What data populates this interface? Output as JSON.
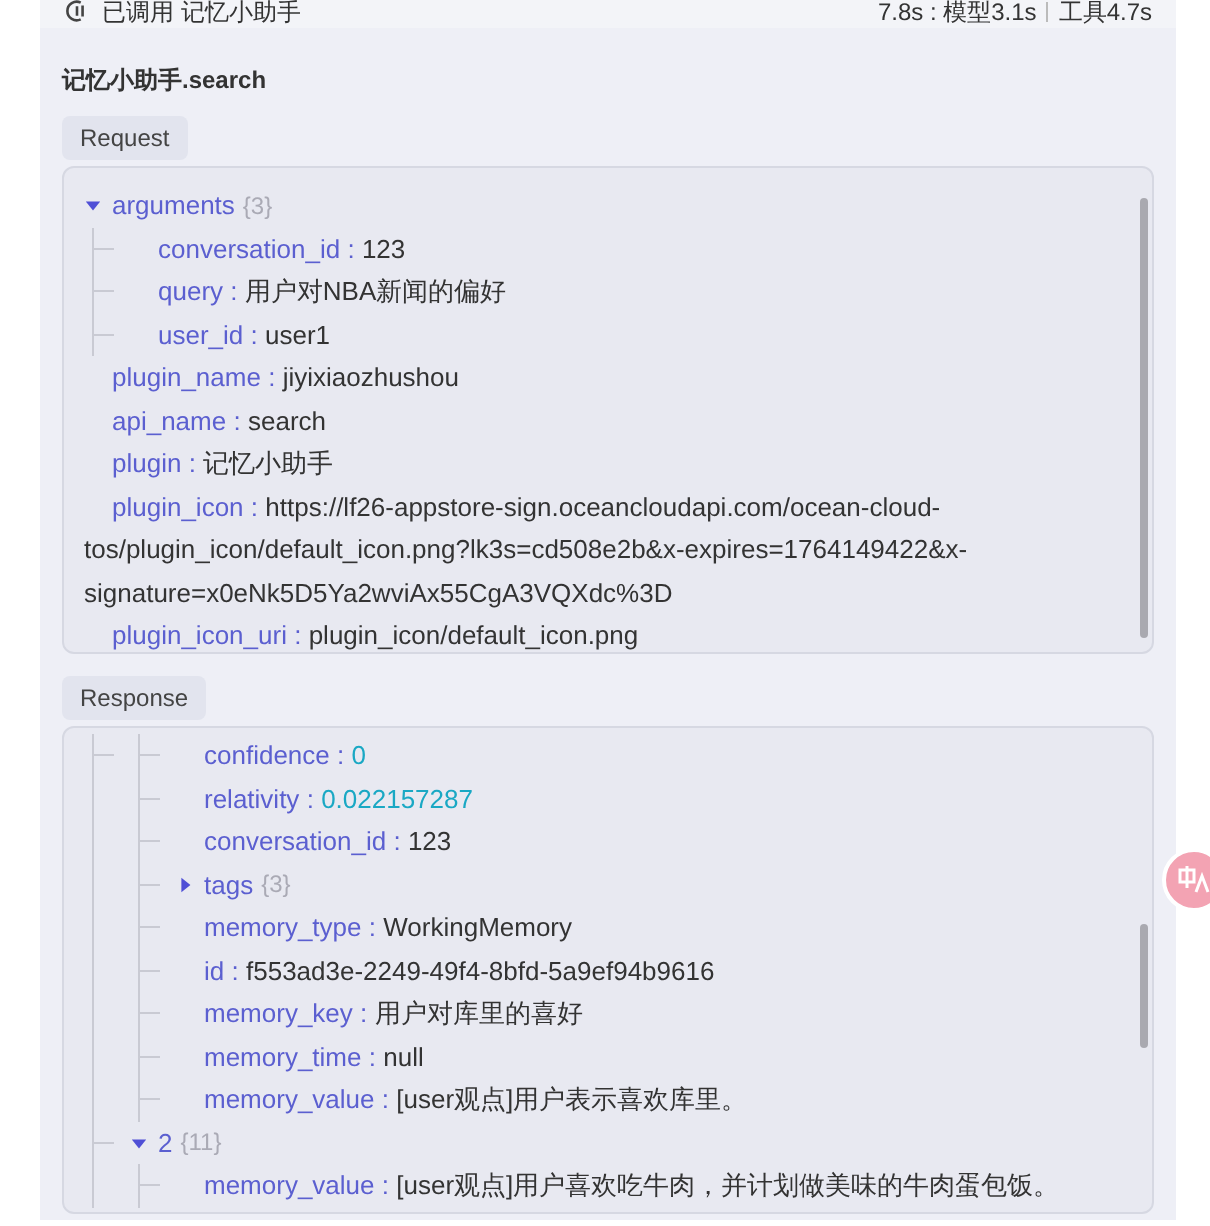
{
  "header": {
    "status": "已调用 记忆小助手",
    "timing_total": "7.8s : 模型3.1s",
    "timing_tool": "工具4.7s"
  },
  "title": "记忆小助手.search",
  "separator": ":",
  "request": {
    "label": "Request",
    "tree": [
      {
        "key": "arguments",
        "count": "{3}",
        "expanded": true,
        "children": [
          {
            "key": "conversation_id",
            "value": "123"
          },
          {
            "key": "query",
            "value": "用户对NBA新闻的偏好"
          },
          {
            "key": "user_id",
            "value": "user1"
          }
        ]
      },
      {
        "key": "plugin_name",
        "value": "jiyixiaozhushou"
      },
      {
        "key": "api_name",
        "value": "search"
      },
      {
        "key": "plugin",
        "value": "记忆小助手"
      },
      {
        "key": "plugin_icon",
        "value": "https://lf26-appstore-sign.oceancloudapi.com/ocean-cloud-tos/plugin_icon/default_icon.png?lk3s=cd508e2b&x-expires=1764149422&x-signature=x0eNk5D5Ya2wviAx55CgA3VQXdc%3D"
      },
      {
        "key": "plugin_icon_uri",
        "value": "plugin_icon/default_icon.png"
      }
    ]
  },
  "response": {
    "label": "Response",
    "tree": [
      {
        "children": [
          {
            "children": [
              {
                "key": "confidence",
                "value": "0",
                "kind": "number"
              },
              {
                "key": "relativity",
                "value": "0.022157287",
                "kind": "number"
              },
              {
                "key": "conversation_id",
                "value": "123"
              },
              {
                "key": "tags",
                "count": "{3}",
                "expanded": false
              },
              {
                "key": "memory_type",
                "value": "WorkingMemory"
              },
              {
                "key": "id",
                "value": "f553ad3e-2249-49f4-8bfd-5a9ef94b9616"
              },
              {
                "key": "memory_key",
                "value": "用户对库里的喜好"
              },
              {
                "key": "memory_time",
                "value": "null"
              },
              {
                "key": "memory_value",
                "value": "[user观点]用户表示喜欢库里。"
              }
            ]
          },
          {
            "key": "2",
            "count": "{11}",
            "expanded": true,
            "children": [
              {
                "key": "memory_value",
                "value": "[user观点]用户喜欢吃牛肉，并计划做美味的牛肉蛋包饭。"
              }
            ]
          }
        ]
      }
    ]
  }
}
